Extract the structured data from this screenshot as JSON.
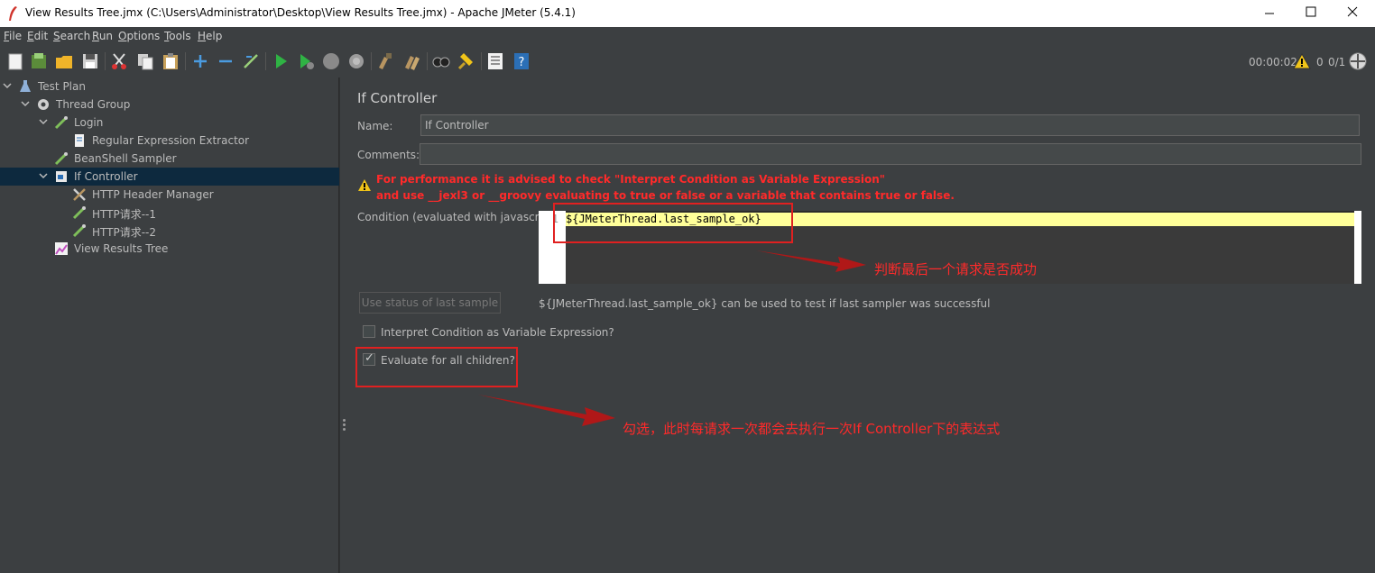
{
  "window": {
    "title": "View Results Tree.jmx (C:\\Users\\Administrator\\Desktop\\View Results Tree.jmx) - Apache JMeter (5.4.1)"
  },
  "menu": [
    {
      "mnemonic": "F",
      "rest": "ile"
    },
    {
      "mnemonic": "E",
      "rest": "dit"
    },
    {
      "mnemonic": "S",
      "rest": "earch"
    },
    {
      "mnemonic": "R",
      "rest": "un"
    },
    {
      "mnemonic": "O",
      "rest": "ptions"
    },
    {
      "mnemonic": "T",
      "rest": "ools"
    },
    {
      "mnemonic": "H",
      "rest": "elp"
    }
  ],
  "toolbar": {
    "timer": "00:00:02",
    "warning_count": "0",
    "threads": "0/1"
  },
  "tree": [
    {
      "label": "Test Plan",
      "icon": "flask-icon"
    },
    {
      "label": "Thread Group",
      "icon": "gear-icon"
    },
    {
      "label": "Login",
      "icon": "pipette-icon"
    },
    {
      "label": "Regular Expression Extractor",
      "icon": "document-icon"
    },
    {
      "label": "BeanShell Sampler",
      "icon": "pipette-icon"
    },
    {
      "label": "If Controller",
      "icon": "controller-icon"
    },
    {
      "label": "HTTP Header Manager",
      "icon": "tools-icon"
    },
    {
      "label": "HTTP请求--1",
      "icon": "pipette-icon"
    },
    {
      "label": "HTTP请求--2",
      "icon": "pipette-icon"
    },
    {
      "label": "View Results Tree",
      "icon": "chart-icon"
    }
  ],
  "panel": {
    "title": "If Controller",
    "name_label": "Name:",
    "name_value": "If Controller",
    "comments_label": "Comments:",
    "comments_value": "",
    "warning_line1": "For performance it is advised to check \"Interpret Condition as Variable Expression\"",
    "warning_line2": "and use __jexl3 or __groovy evaluating to true or false or a variable that contains true or false.",
    "condition_label": "Condition (evaluated with javascript)",
    "line_number": "1",
    "condition_code": "${JMeterThread.last_sample_ok}",
    "use_status_button": "Use status of last sample",
    "hint": "${JMeterThread.last_sample_ok} can be used to test if last sampler was successful",
    "interpret_label": "Interpret Condition as Variable Expression?",
    "interpret_checked": false,
    "evaluate_label": "Evaluate for all children?",
    "evaluate_checked": true
  },
  "annotations": {
    "note1": "判断最后一个请求是否成功",
    "note2": "勾选，此时每请求一次都会去执行一次If Controller下的表达式"
  },
  "colors": {
    "background": "#3c3f41",
    "selection": "#0d293e",
    "annotation_red": "#e02020",
    "editor_highlight": "#ffff99"
  }
}
